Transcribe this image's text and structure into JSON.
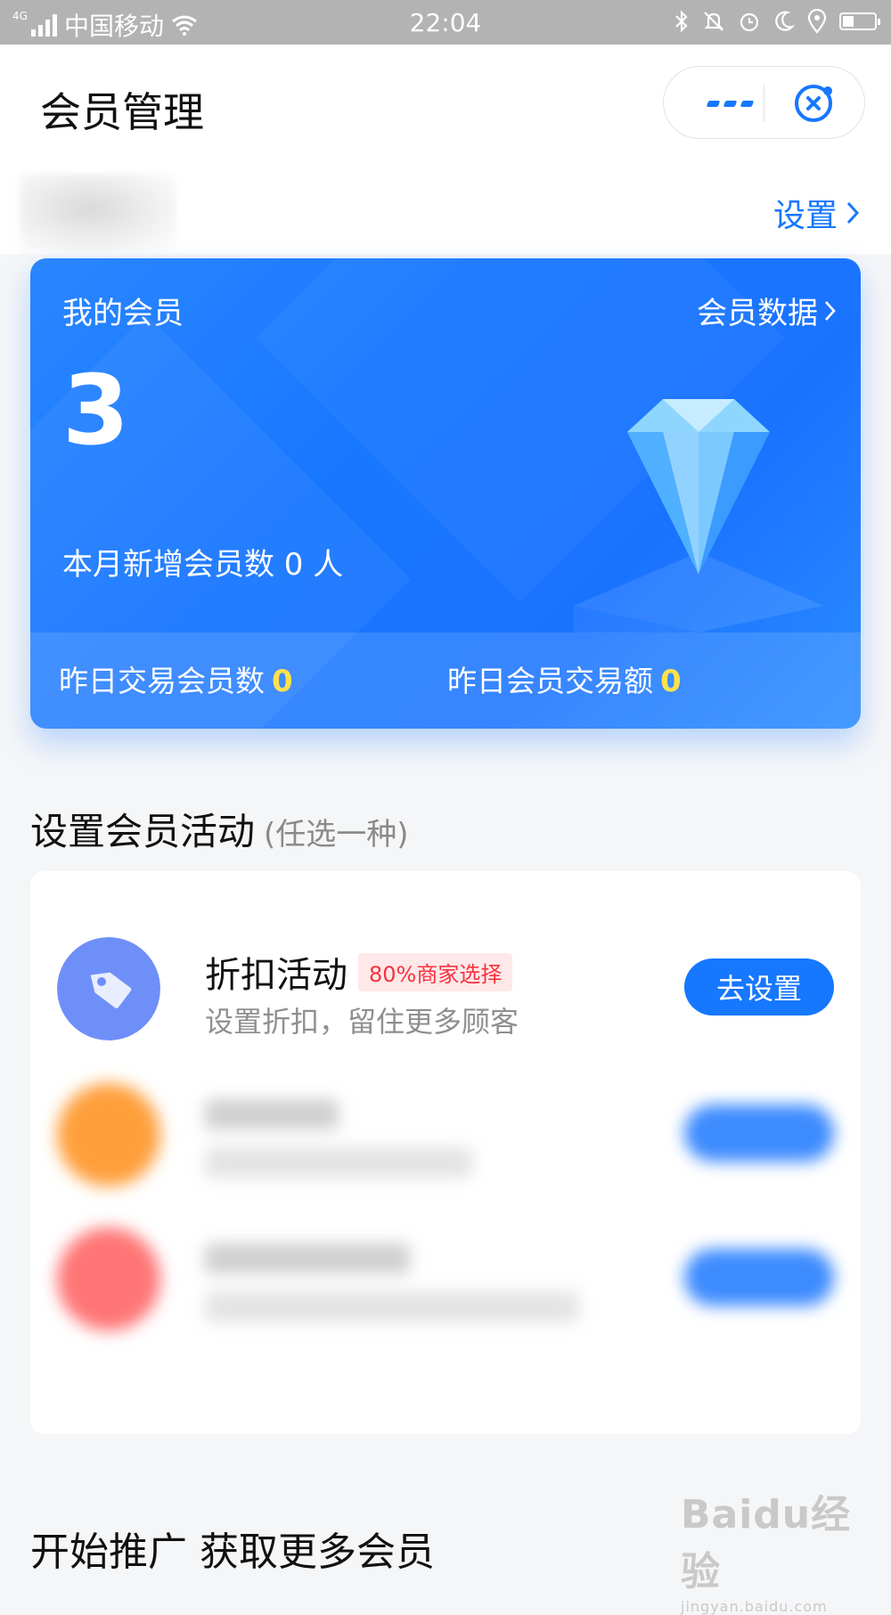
{
  "status_bar": {
    "network_type": "4G",
    "carrier": "中国移动",
    "time": "22:04",
    "icons": [
      "signal-icon",
      "wifi-icon",
      "bluetooth-icon",
      "mute-bell-icon",
      "alarm-icon",
      "moon-icon",
      "location-icon",
      "battery-icon"
    ],
    "battery_level": 0.35
  },
  "header": {
    "title": "会员管理",
    "more_icon": "more-dots-icon",
    "close_icon": "close-circle-icon"
  },
  "subheader": {
    "settings_label": "设置"
  },
  "member_card": {
    "title": "我的会员",
    "data_link_label": "会员数据",
    "member_count": "3",
    "new_this_month": "本月新增会员数 0 人",
    "yesterday_trade_members_label": "昨日交易会员数",
    "yesterday_trade_members_value": "0",
    "yesterday_trade_amount_label": "昨日会员交易额",
    "yesterday_trade_amount_value": "0"
  },
  "activities_section": {
    "title": "设置会员活动",
    "hint": "(任选一种)",
    "items": [
      {
        "name": "折扣活动",
        "badge": "80%商家选择",
        "description": "设置折扣，留住更多顾客",
        "button_label": "去设置",
        "icon": "tag-icon",
        "color": "#6f8ff8"
      }
    ],
    "blurred_colors": [
      "#ff9f3c",
      "#ff7575"
    ]
  },
  "promo": {
    "title": "开始推广 获取更多会员"
  },
  "watermark": {
    "brand": "Baidu经验",
    "url": "jingyan.baidu.com"
  },
  "colors": {
    "accent": "#1677ff",
    "highlight": "#ffe14d",
    "badge_red": "#f5333f"
  }
}
